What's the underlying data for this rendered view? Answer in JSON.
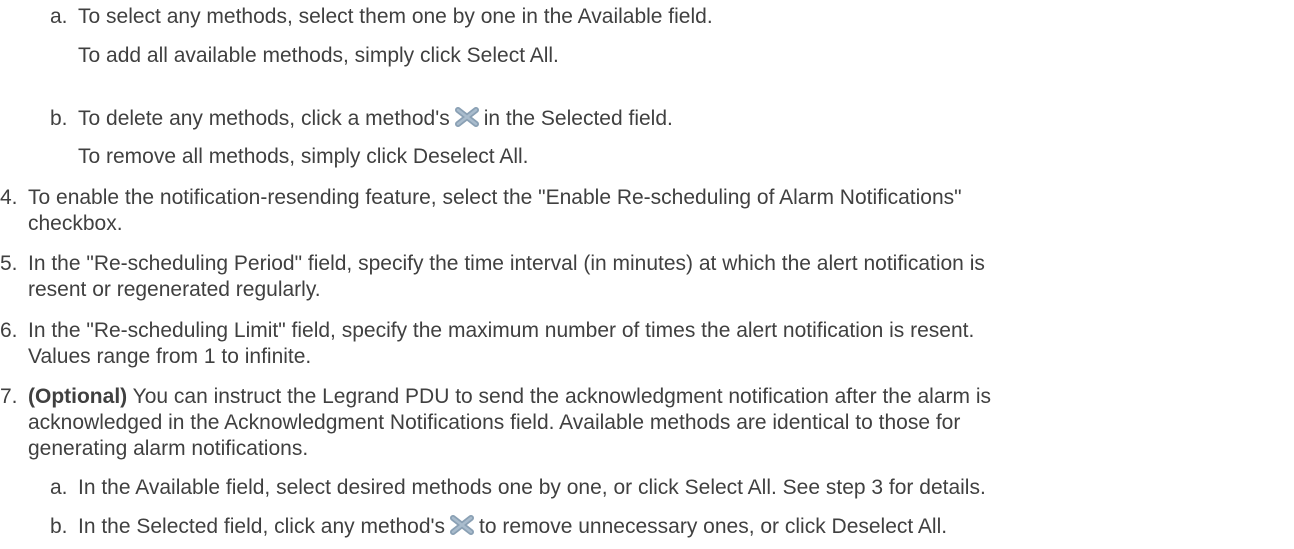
{
  "substeps_top": {
    "a": {
      "marker": "a.",
      "line1": "To select any methods, select them one by one in the Available field.",
      "line2": "To add all available methods, simply click Select All."
    },
    "b": {
      "marker": "b.",
      "line1_before": "To delete any methods, click a method's",
      "line1_after": "in the Selected field.",
      "line2": "To remove all methods, simply click Deselect All."
    }
  },
  "steps": {
    "s4": {
      "marker": "4.",
      "line1": "To enable the notification-resending feature, select the \"Enable Re-scheduling of Alarm Notifications\"",
      "line2": "checkbox."
    },
    "s5": {
      "marker": "5.",
      "line1": "In the \"Re-scheduling Period\" field, specify the time interval (in minutes) at which the alert notification is",
      "line2": "resent or regenerated regularly."
    },
    "s6": {
      "marker": "6.",
      "line1": "In the \"Re-scheduling Limit\" field, specify the maximum number of times the alert notification is resent.",
      "line2": "Values range from 1 to infinite."
    },
    "s7": {
      "marker": "7.",
      "line1_bold": "(Optional)",
      "line1_rest": " You can instruct the Legrand PDU to send the acknowledgment notification after the alarm is",
      "line2": "acknowledged in the Acknowledgment Notifications field. Available methods are identical to those for",
      "line3": "generating alarm notifications.",
      "a": {
        "marker": "a.",
        "text": "In the Available field, select desired methods one by one, or click Select All. See step 3 for details."
      },
      "b": {
        "marker": "b.",
        "text_before": "In the Selected field, click any method's",
        "text_after": "to remove unnecessary ones, or click Deselect All."
      }
    }
  },
  "icon": {
    "name": "delete-x-icon",
    "color": "#8aa0b4"
  }
}
